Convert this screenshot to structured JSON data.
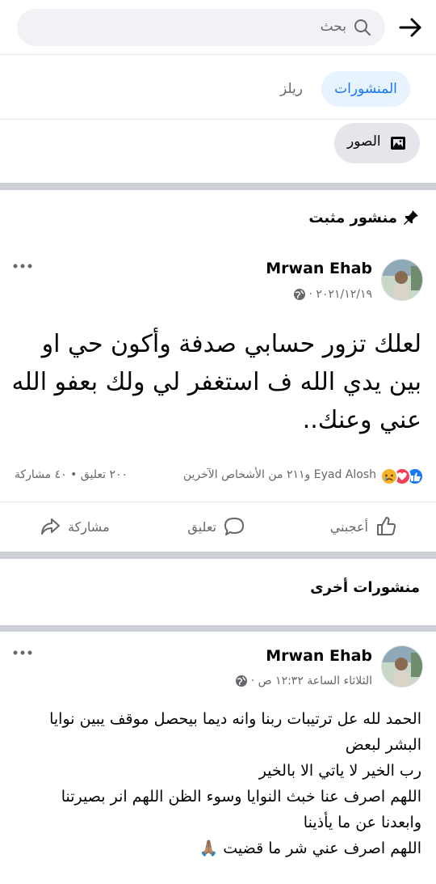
{
  "header": {
    "search_placeholder": "بحث",
    "back_icon": "arrow-right-icon",
    "search_icon": "search-icon"
  },
  "tabs": [
    {
      "label": "المنشورات",
      "active": true
    },
    {
      "label": "ريلز",
      "active": false
    }
  ],
  "photos_chip": {
    "label": "الصور",
    "icon": "photo-album-icon"
  },
  "pinned_section": {
    "title": "منشور مثبت",
    "icon": "pin-icon"
  },
  "pinned_post": {
    "author": "Mrwan Ehab",
    "date": "٢٠٢١/١٢/١٩ ·",
    "text_lines": [
      "لعلك تزور حسابي صدفة وأكون حي او",
      "بين يدي الله ف استغفر لي ولك بعفو الله",
      "عني وعنك.."
    ],
    "reactions_text": "Eyad Alosh و٢١١ من الأشخاص الآخرين",
    "counts_text": "٢٠٠ تعليق • ٤٠ مشاركة",
    "reaction_icons": [
      "sad-face-icon",
      "love-heart-icon",
      "like-thumb-icon"
    ]
  },
  "actions": {
    "like": "أعجبني",
    "comment": "تعليق",
    "share": "مشاركة"
  },
  "other_posts_section": {
    "title": "منشورات أخرى"
  },
  "second_post": {
    "author": "Mrwan Ehab",
    "date": "الثلاثاء الساعة ١٢:٣٢ ص ·",
    "lines": [
      "الحمد لله عل ترتيبات ربنا وانه ديما بيحصل موقف يبين نوايا",
      "البشر لبعض",
      "رب الخير لا ياتي الا بالخير",
      "اللهم اصرف عنا خبث النوايا وسوء الظن اللهم انر بصيرتنا",
      "وابعدنا عن ما يأذينا",
      "اللهم اصرف عني شر ما قضيت 🙏🏽"
    ]
  },
  "colors": {
    "accent": "#1877f2",
    "tab_active_bg": "#e7f3ff",
    "separator": "#ccd0d5",
    "secondary_text": "#65676b"
  }
}
